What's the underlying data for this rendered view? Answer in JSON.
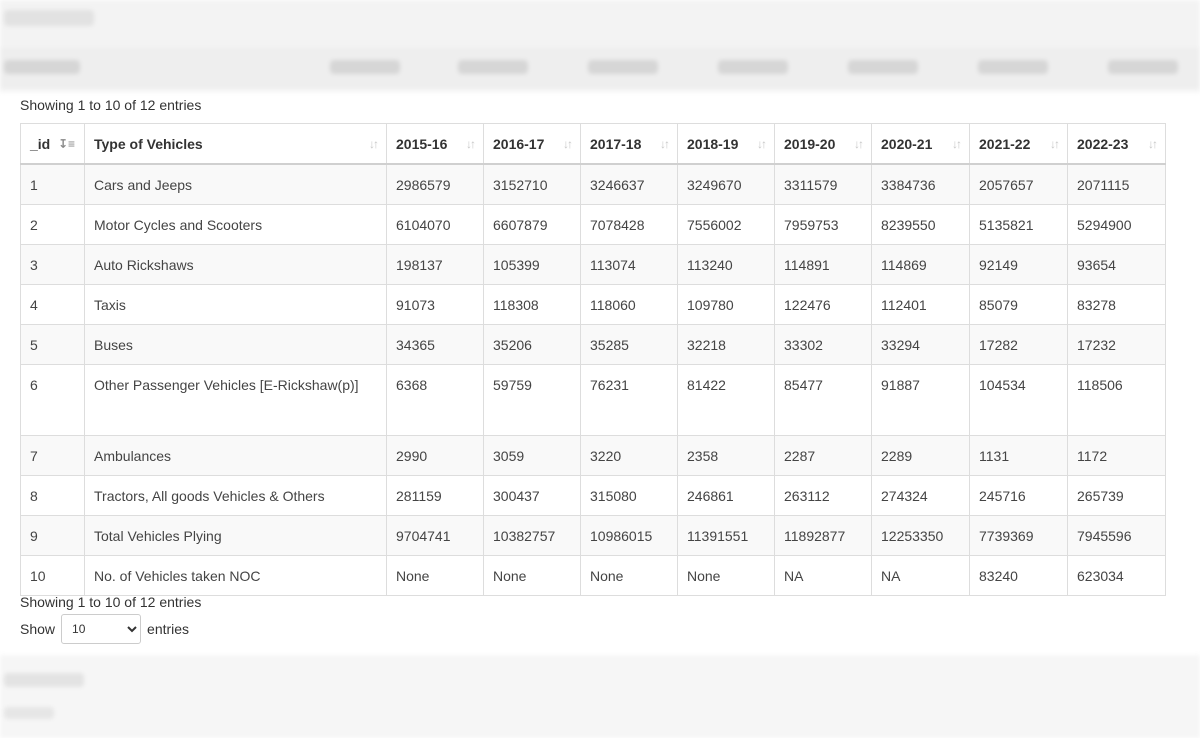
{
  "info": {
    "top": "Showing 1 to 10 of 12 entries",
    "bottom": "Showing 1 to 10 of 12 entries"
  },
  "length": {
    "show_label": "Show",
    "entries_label": "entries",
    "selected": "10"
  },
  "table": {
    "columns": [
      "_id",
      "Type of Vehicles",
      "2015-16",
      "2016-17",
      "2017-18",
      "2018-19",
      "2019-20",
      "2020-21",
      "2021-22",
      "2022-23"
    ],
    "sorted_column": "_id",
    "rows": [
      [
        "1",
        "Cars and Jeeps",
        "2986579",
        "3152710",
        "3246637",
        "3249670",
        "3311579",
        "3384736",
        "2057657",
        "2071115"
      ],
      [
        "2",
        "Motor Cycles and Scooters",
        "6104070",
        "6607879",
        "7078428",
        "7556002",
        "7959753",
        "8239550",
        "5135821",
        "5294900"
      ],
      [
        "3",
        "Auto Rickshaws",
        "198137",
        "105399",
        "113074",
        "113240",
        "114891",
        "114869",
        "92149",
        "93654"
      ],
      [
        "4",
        "Taxis",
        "91073",
        "118308",
        "118060",
        "109780",
        "122476",
        "112401",
        "85079",
        "83278"
      ],
      [
        "5",
        "Buses",
        "34365",
        "35206",
        "35285",
        "32218",
        "33302",
        "33294",
        "17282",
        "17232"
      ],
      [
        "6",
        "Other Passenger Vehicles [E-Rickshaw(p)]",
        "6368",
        "59759",
        "76231",
        "81422",
        "85477",
        "91887",
        "104534",
        "118506"
      ],
      [
        "7",
        "Ambulances",
        "2990",
        "3059",
        "3220",
        "2358",
        "2287",
        "2289",
        "1131",
        "1172"
      ],
      [
        "8",
        "Tractors, All goods Vehicles & Others",
        "281159",
        "300437",
        "315080",
        "246861",
        "263112",
        "274324",
        "245716",
        "265739"
      ],
      [
        "9",
        "Total Vehicles Plying",
        "9704741",
        "10382757",
        "10986015",
        "11391551",
        "11892877",
        "12253350",
        "7739369",
        "7945596"
      ],
      [
        "10",
        "No. of Vehicles taken NOC",
        "None",
        "None",
        "None",
        "None",
        "NA",
        "NA",
        "83240",
        "623034"
      ]
    ]
  }
}
